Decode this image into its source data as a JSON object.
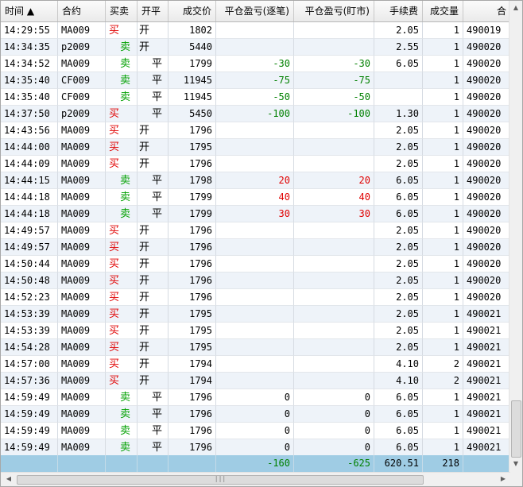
{
  "columns": [
    "时间 ▲",
    "合约",
    "买卖",
    "开平",
    "成交价",
    "平仓盈亏(逐笔)",
    "平仓盈亏(盯市)",
    "手续费",
    "成交量",
    "合"
  ],
  "rows": [
    {
      "time": "14:29:55",
      "contract": "MA009",
      "side": "买",
      "oc": "开",
      "price": "1802",
      "pnl_a": "",
      "pnl_b": "",
      "fee": "2.05",
      "vol": "1",
      "id": "490019"
    },
    {
      "time": "14:34:35",
      "contract": "p2009",
      "side": "卖",
      "oc": "开",
      "price": "5440",
      "pnl_a": "",
      "pnl_b": "",
      "fee": "2.55",
      "vol": "1",
      "id": "490020"
    },
    {
      "time": "14:34:52",
      "contract": "MA009",
      "side": "卖",
      "oc": "平",
      "price": "1799",
      "pnl_a": "-30",
      "pnl_b": "-30",
      "fee": "6.05",
      "vol": "1",
      "id": "490020"
    },
    {
      "time": "14:35:40",
      "contract": "CF009",
      "side": "卖",
      "oc": "平",
      "price": "11945",
      "pnl_a": "-75",
      "pnl_b": "-75",
      "fee": "",
      "vol": "1",
      "id": "490020"
    },
    {
      "time": "14:35:40",
      "contract": "CF009",
      "side": "卖",
      "oc": "平",
      "price": "11945",
      "pnl_a": "-50",
      "pnl_b": "-50",
      "fee": "",
      "vol": "1",
      "id": "490020"
    },
    {
      "time": "14:37:50",
      "contract": "p2009",
      "side": "买",
      "oc": "平",
      "price": "5450",
      "pnl_a": "-100",
      "pnl_b": "-100",
      "fee": "1.30",
      "vol": "1",
      "id": "490020"
    },
    {
      "time": "14:43:56",
      "contract": "MA009",
      "side": "买",
      "oc": "开",
      "price": "1796",
      "pnl_a": "",
      "pnl_b": "",
      "fee": "2.05",
      "vol": "1",
      "id": "490020"
    },
    {
      "time": "14:44:00",
      "contract": "MA009",
      "side": "买",
      "oc": "开",
      "price": "1795",
      "pnl_a": "",
      "pnl_b": "",
      "fee": "2.05",
      "vol": "1",
      "id": "490020"
    },
    {
      "time": "14:44:09",
      "contract": "MA009",
      "side": "买",
      "oc": "开",
      "price": "1796",
      "pnl_a": "",
      "pnl_b": "",
      "fee": "2.05",
      "vol": "1",
      "id": "490020"
    },
    {
      "time": "14:44:15",
      "contract": "MA009",
      "side": "卖",
      "oc": "平",
      "price": "1798",
      "pnl_a": "20",
      "pnl_b": "20",
      "fee": "6.05",
      "vol": "1",
      "id": "490020"
    },
    {
      "time": "14:44:18",
      "contract": "MA009",
      "side": "卖",
      "oc": "平",
      "price": "1799",
      "pnl_a": "40",
      "pnl_b": "40",
      "fee": "6.05",
      "vol": "1",
      "id": "490020"
    },
    {
      "time": "14:44:18",
      "contract": "MA009",
      "side": "卖",
      "oc": "平",
      "price": "1799",
      "pnl_a": "30",
      "pnl_b": "30",
      "fee": "6.05",
      "vol": "1",
      "id": "490020"
    },
    {
      "time": "14:49:57",
      "contract": "MA009",
      "side": "买",
      "oc": "开",
      "price": "1796",
      "pnl_a": "",
      "pnl_b": "",
      "fee": "2.05",
      "vol": "1",
      "id": "490020"
    },
    {
      "time": "14:49:57",
      "contract": "MA009",
      "side": "买",
      "oc": "开",
      "price": "1796",
      "pnl_a": "",
      "pnl_b": "",
      "fee": "2.05",
      "vol": "1",
      "id": "490020"
    },
    {
      "time": "14:50:44",
      "contract": "MA009",
      "side": "买",
      "oc": "开",
      "price": "1796",
      "pnl_a": "",
      "pnl_b": "",
      "fee": "2.05",
      "vol": "1",
      "id": "490020"
    },
    {
      "time": "14:50:48",
      "contract": "MA009",
      "side": "买",
      "oc": "开",
      "price": "1796",
      "pnl_a": "",
      "pnl_b": "",
      "fee": "2.05",
      "vol": "1",
      "id": "490020"
    },
    {
      "time": "14:52:23",
      "contract": "MA009",
      "side": "买",
      "oc": "开",
      "price": "1796",
      "pnl_a": "",
      "pnl_b": "",
      "fee": "2.05",
      "vol": "1",
      "id": "490020"
    },
    {
      "time": "14:53:39",
      "contract": "MA009",
      "side": "买",
      "oc": "开",
      "price": "1795",
      "pnl_a": "",
      "pnl_b": "",
      "fee": "2.05",
      "vol": "1",
      "id": "490021"
    },
    {
      "time": "14:53:39",
      "contract": "MA009",
      "side": "买",
      "oc": "开",
      "price": "1795",
      "pnl_a": "",
      "pnl_b": "",
      "fee": "2.05",
      "vol": "1",
      "id": "490021"
    },
    {
      "time": "14:54:28",
      "contract": "MA009",
      "side": "买",
      "oc": "开",
      "price": "1795",
      "pnl_a": "",
      "pnl_b": "",
      "fee": "2.05",
      "vol": "1",
      "id": "490021"
    },
    {
      "time": "14:57:00",
      "contract": "MA009",
      "side": "买",
      "oc": "开",
      "price": "1794",
      "pnl_a": "",
      "pnl_b": "",
      "fee": "4.10",
      "vol": "2",
      "id": "490021"
    },
    {
      "time": "14:57:36",
      "contract": "MA009",
      "side": "买",
      "oc": "开",
      "price": "1794",
      "pnl_a": "",
      "pnl_b": "",
      "fee": "4.10",
      "vol": "2",
      "id": "490021"
    },
    {
      "time": "14:59:49",
      "contract": "MA009",
      "side": "卖",
      "oc": "平",
      "price": "1796",
      "pnl_a": "0",
      "pnl_b": "0",
      "fee": "6.05",
      "vol": "1",
      "id": "490021"
    },
    {
      "time": "14:59:49",
      "contract": "MA009",
      "side": "卖",
      "oc": "平",
      "price": "1796",
      "pnl_a": "0",
      "pnl_b": "0",
      "fee": "6.05",
      "vol": "1",
      "id": "490021"
    },
    {
      "time": "14:59:49",
      "contract": "MA009",
      "side": "卖",
      "oc": "平",
      "price": "1796",
      "pnl_a": "0",
      "pnl_b": "0",
      "fee": "6.05",
      "vol": "1",
      "id": "490021"
    },
    {
      "time": "14:59:49",
      "contract": "MA009",
      "side": "卖",
      "oc": "平",
      "price": "1796",
      "pnl_a": "0",
      "pnl_b": "0",
      "fee": "6.05",
      "vol": "1",
      "id": "490021"
    }
  ],
  "totals": {
    "pnl_a": "-160",
    "pnl_b": "-625",
    "fee": "620.51",
    "vol": "218"
  },
  "scrollbar": {
    "up_icon": "▲",
    "down_icon": "▼",
    "left_icon": "◀",
    "right_icon": "▶",
    "grip": "|||"
  },
  "colors": {
    "buy": "#e00000",
    "sell": "#00a000",
    "loss": "#008000",
    "profit": "#e00000",
    "total_row": "#9fcce4",
    "alt_row": "#eef3f9"
  }
}
